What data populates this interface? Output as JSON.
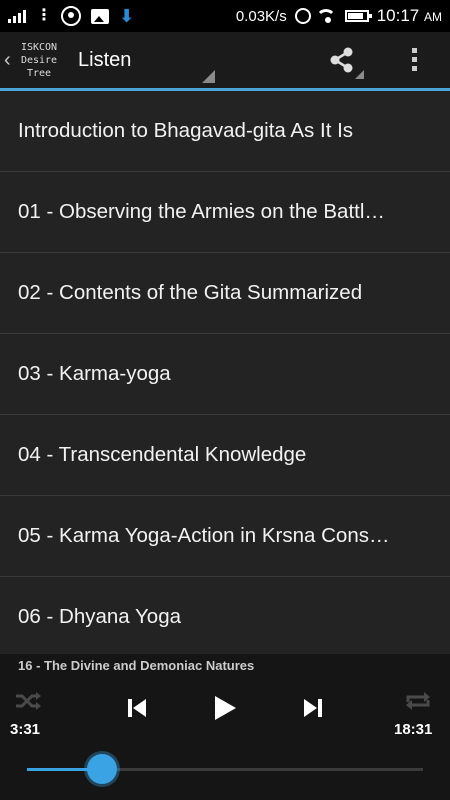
{
  "status_bar": {
    "speed": "0.03K/s",
    "time": "10:17",
    "ampm": "AM"
  },
  "action_bar": {
    "logo_lines": [
      "ISKCON",
      "Desire",
      "Tree"
    ],
    "title": "Listen"
  },
  "tracks": [
    "Introduction to Bhagavad-gita As It Is",
    "01 - Observing the Armies on the Battl…",
    "02 - Contents of the Gita Summarized",
    "03 - Karma-yoga",
    "04 - Transcendental Knowledge",
    "05 - Karma Yoga-Action in Krsna Cons…",
    "06 - Dhyana Yoga"
  ],
  "player": {
    "now_playing": "16 - The Divine and Demoniac Natures",
    "elapsed": "3:31",
    "duration": "18:31",
    "progress": 0.19
  },
  "colors": {
    "accent": "#4aa5d9",
    "progress": "#3aa3e3",
    "background": "#232323"
  }
}
